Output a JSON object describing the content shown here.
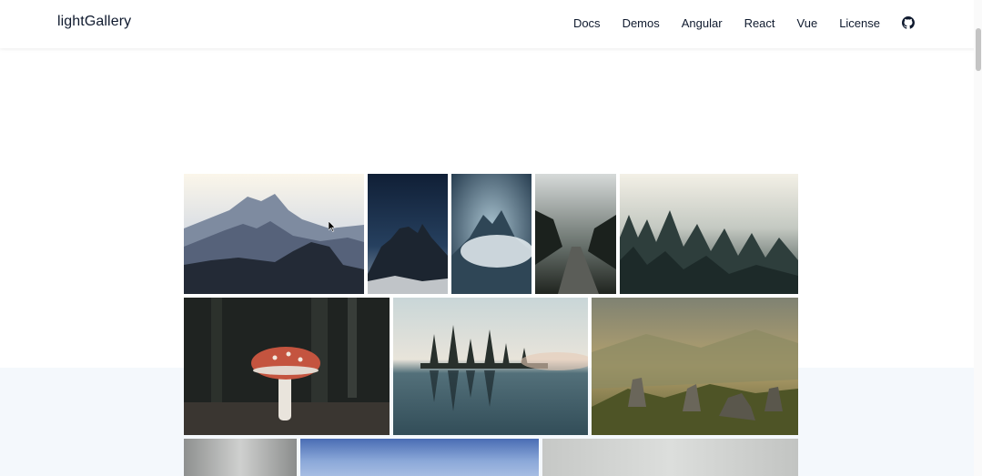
{
  "header": {
    "brand": "lightGallery",
    "nav": [
      {
        "label": "Docs"
      },
      {
        "label": "Demos"
      },
      {
        "label": "Angular"
      },
      {
        "label": "React"
      },
      {
        "label": "Vue"
      },
      {
        "label": "License"
      }
    ],
    "github_icon": "github-icon"
  },
  "colors": {
    "nav_text": "#0f1a2e",
    "band_bg": "#f4f8fc"
  },
  "gallery": {
    "items": [
      {
        "subject": "mountain-silhouettes"
      },
      {
        "subject": "night-sky-peaks"
      },
      {
        "subject": "misty-mountain"
      },
      {
        "subject": "foggy-road"
      },
      {
        "subject": "foggy-forest"
      },
      {
        "subject": "red-mushroom"
      },
      {
        "subject": "lake-reflection"
      },
      {
        "subject": "golden-valley-rocks"
      },
      {
        "subject": "gray-sky"
      },
      {
        "subject": "blue-horizon"
      },
      {
        "subject": "pale-haze"
      }
    ]
  }
}
